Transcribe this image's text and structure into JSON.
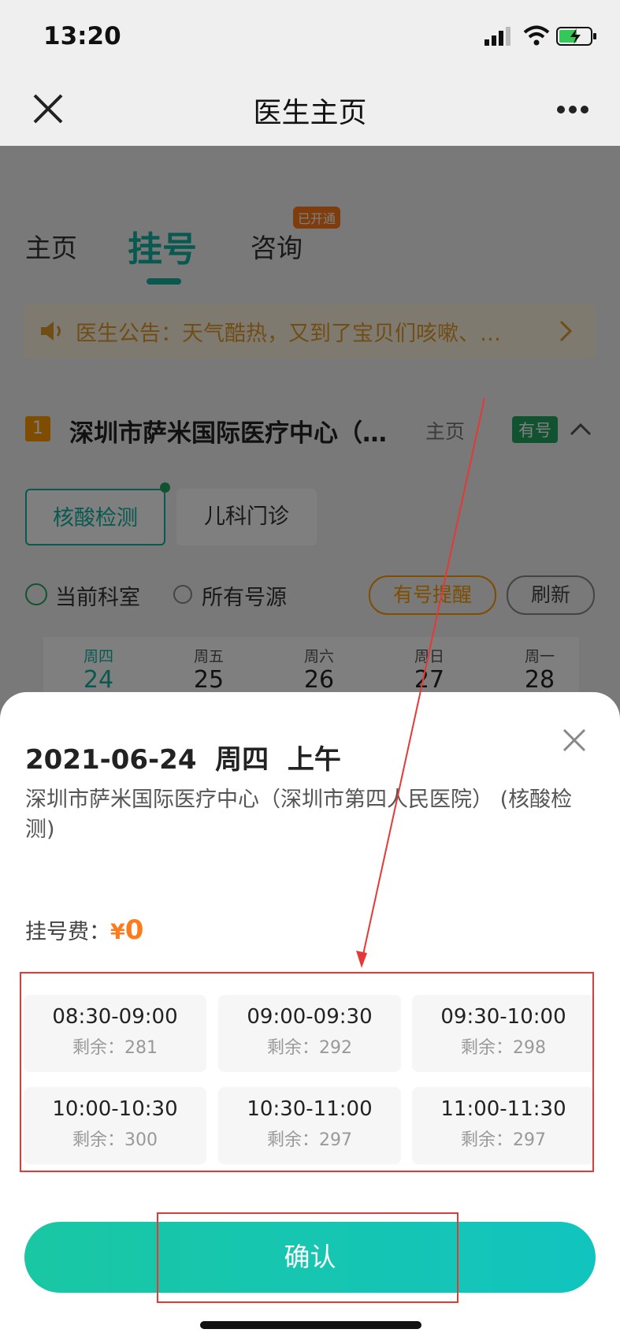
{
  "status_bar": {
    "time": "13:20"
  },
  "nav": {
    "title": "医生主页"
  },
  "tabs": [
    {
      "label": "主页"
    },
    {
      "label": "挂号"
    },
    {
      "label": "咨询",
      "badge": "已开通"
    }
  ],
  "notice": {
    "text": "医生公告：天气酷热，又到了宝贝们咳嗽、…"
  },
  "hospital": {
    "index": "1",
    "name": "深圳市萨米国际医疗中心（…",
    "link": "主页",
    "status": "有号"
  },
  "departments": [
    {
      "label": "核酸检测"
    },
    {
      "label": "儿科门诊"
    }
  ],
  "filters": {
    "current": "当前科室",
    "all": "所有号源",
    "remind": "有号提醒",
    "refresh": "刷新"
  },
  "days": [
    {
      "weekday": "周四",
      "date": "24"
    },
    {
      "weekday": "周五",
      "date": "25"
    },
    {
      "weekday": "周六",
      "date": "26"
    },
    {
      "weekday": "周日",
      "date": "27"
    },
    {
      "weekday": "周一",
      "date": "28"
    }
  ],
  "sheet": {
    "date": "2021-06-24",
    "weekday": "周四",
    "period": "上午",
    "location": "深圳市萨米国际医疗中心（深圳市第四人民医院） (核酸检测)",
    "fee_label": "挂号费：",
    "fee_currency": "¥",
    "fee_value": "0",
    "confirm_label": "确认"
  },
  "slots": [
    {
      "time": "08:30-09:00",
      "remain_label": "剩余：281"
    },
    {
      "time": "09:00-09:30",
      "remain_label": "剩余：292"
    },
    {
      "time": "09:30-10:00",
      "remain_label": "剩余：298"
    },
    {
      "time": "10:00-10:30",
      "remain_label": "剩余：300"
    },
    {
      "time": "10:30-11:00",
      "remain_label": "剩余：297"
    },
    {
      "time": "11:00-11:30",
      "remain_label": "剩余：297"
    }
  ],
  "colors": {
    "accent": "#12b3a0",
    "fee": "#ff7a1a",
    "annotation": "#e53935"
  }
}
